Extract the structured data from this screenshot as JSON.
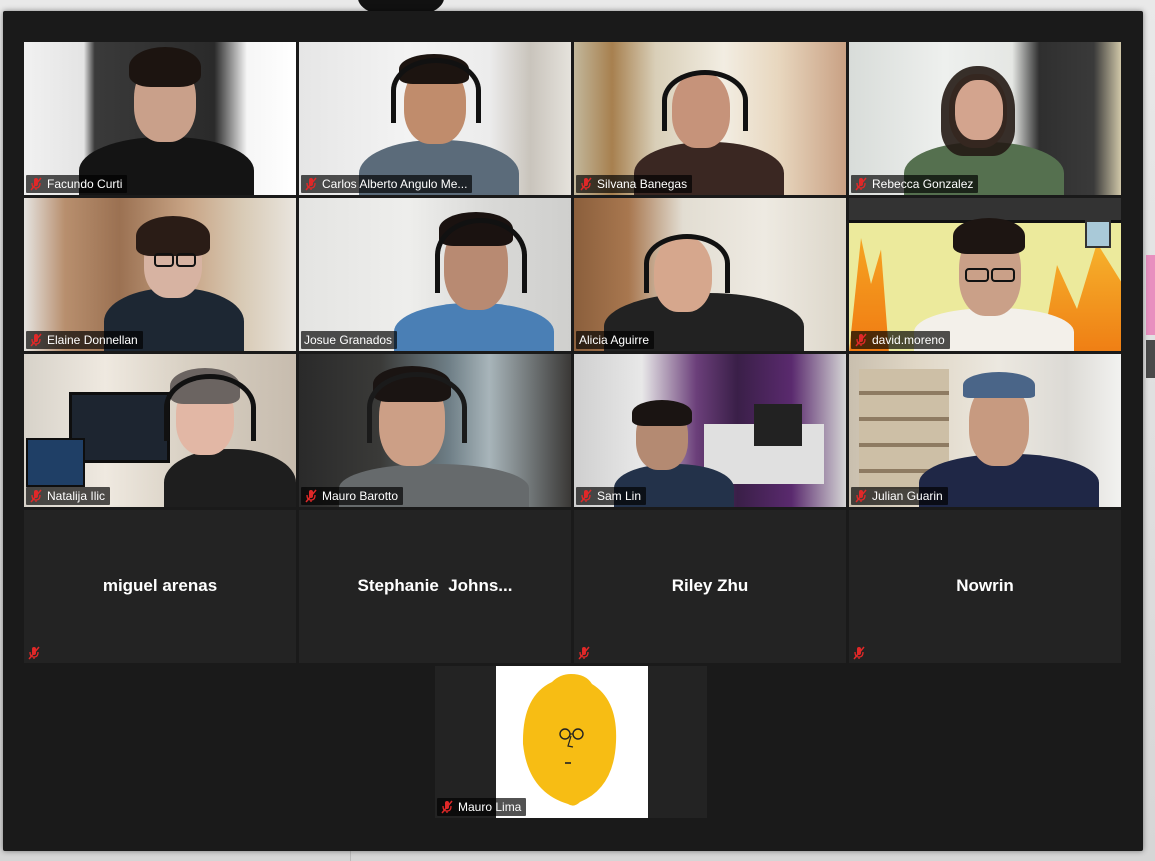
{
  "meeting": {
    "participants": [
      {
        "name": "Facundo Curti",
        "muted": true,
        "video": true
      },
      {
        "name": "Carlos Alberto Angulo Me...",
        "muted": true,
        "video": true
      },
      {
        "name": "Silvana Banegas",
        "muted": true,
        "video": true
      },
      {
        "name": "Rebecca Gonzalez",
        "muted": true,
        "video": true
      },
      {
        "name": "Elaine Donnellan",
        "muted": true,
        "video": true
      },
      {
        "name": "Josue Granados",
        "muted": false,
        "video": true,
        "active_speaker": true
      },
      {
        "name": "Alicia Aguirre",
        "muted": false,
        "video": true
      },
      {
        "name": "david.moreno",
        "muted": true,
        "video": true
      },
      {
        "name": "Natalija Ilic",
        "muted": true,
        "video": true
      },
      {
        "name": "Mauro Barotto",
        "muted": true,
        "video": true
      },
      {
        "name": "Sam Lin",
        "muted": true,
        "video": true
      },
      {
        "name": "Julian Guarin",
        "muted": true,
        "video": true
      },
      {
        "name": "miguel arenas",
        "muted": true,
        "video": false
      },
      {
        "name": "Stephanie  Johns...",
        "muted": false,
        "video": false
      },
      {
        "name": "Riley Zhu",
        "muted": true,
        "video": false
      },
      {
        "name": "Nowrin",
        "muted": true,
        "video": false
      },
      {
        "name": "Mauro Lima",
        "muted": true,
        "video": true,
        "avatar": "lemon"
      }
    ]
  },
  "icons": {
    "muted_mic": "microphone-muted-icon"
  },
  "colors": {
    "window_bg": "#1a1a1a",
    "tile_bg": "#232323",
    "muted_red": "#e02828",
    "active_border": "#cfe33b",
    "lemon_yellow": "#f7bd14"
  }
}
